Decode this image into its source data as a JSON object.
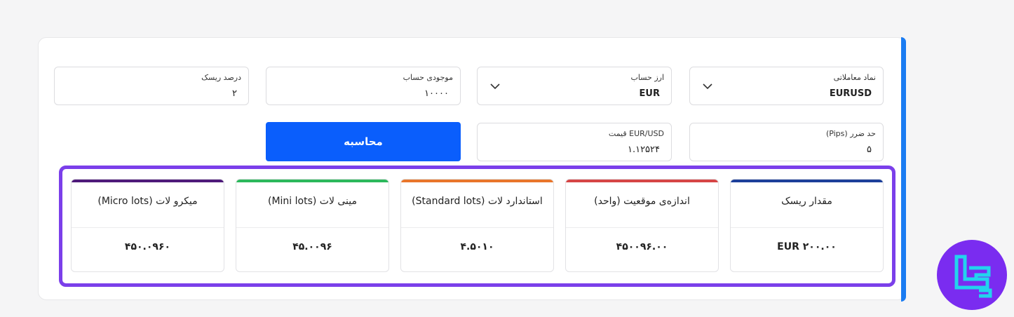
{
  "form": {
    "symbol": {
      "label": "نماد معاملاتی",
      "value": "EURUSD"
    },
    "currency": {
      "label": "ارز حساب",
      "value": "EUR"
    },
    "balance": {
      "label": "موجودی حساب",
      "value": "۱۰۰۰۰"
    },
    "risk_percent": {
      "label": "درصد ریسک",
      "value": "۲"
    },
    "stop_loss": {
      "label": "حد ضرر (Pips)",
      "value": "۵"
    },
    "price": {
      "label": "EUR/USD قیمت",
      "value": "۱.۱۲۵۲۴"
    },
    "calculate_label": "محاسبه"
  },
  "results": [
    {
      "title": "مقدار ریسک",
      "value": "EUR ۲۰۰.۰۰",
      "color": "#1c3f9a"
    },
    {
      "title": "اندازه‌ی موقعیت (واحد)",
      "value": "۴۵۰۰۹۶.۰۰",
      "color": "#d64545"
    },
    {
      "title": "استاندارد لات (Standard lots)",
      "value": "۴.۵۰۱۰",
      "color": "#e9762b"
    },
    {
      "title": "مینی لات (Mini lots)",
      "value": "۴۵.۰۰۹۶",
      "color": "#2cb85c"
    },
    {
      "title": "میکرو لات (Micro lots)",
      "value": "۴۵۰.۰۹۶۰",
      "color": "#4e1a7a"
    }
  ],
  "colors": {
    "accent": "#0a5efc",
    "highlight": "#7b3fea",
    "logo_bg": "#7a2cf0",
    "logo_fg": "#22d3ee"
  },
  "logo": {
    "icon": "tc-logo-icon"
  }
}
